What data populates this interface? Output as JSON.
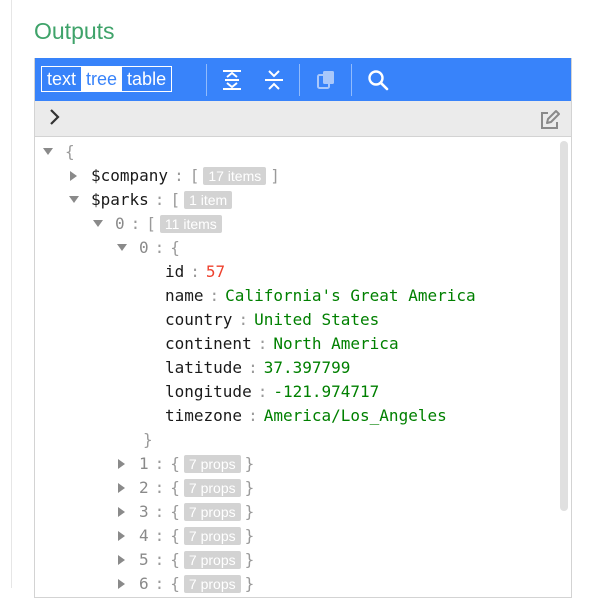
{
  "panel": {
    "title": "Outputs"
  },
  "toolbar": {
    "modes": [
      "text",
      "tree",
      "table"
    ],
    "active_mode": "tree",
    "accent": "#3883fa",
    "buttons": [
      "expand-all-icon",
      "collapse-all-icon",
      "copy-icon",
      "search-icon"
    ]
  },
  "tree": {
    "root_open": "{",
    "company": {
      "key": "$company",
      "open": "[",
      "badge": "17 items",
      "close": "]"
    },
    "parks": {
      "key": "$parks",
      "open": "[",
      "badge": "1 item"
    },
    "group": {
      "index": "0",
      "open": "[",
      "badge": "11 items"
    },
    "park": {
      "index": "0",
      "open": "{",
      "close": "}",
      "fields": [
        {
          "key": "id",
          "value": "57",
          "type": "number"
        },
        {
          "key": "name",
          "value": "California's Great America",
          "type": "string"
        },
        {
          "key": "country",
          "value": "United States",
          "type": "string"
        },
        {
          "key": "continent",
          "value": "North America",
          "type": "string"
        },
        {
          "key": "latitude",
          "value": "37.397799",
          "type": "number-green"
        },
        {
          "key": "longitude",
          "value": "-121.974717",
          "type": "number-green"
        },
        {
          "key": "timezone",
          "value": "America/Los_Angeles",
          "type": "string"
        }
      ]
    },
    "collapsed": [
      {
        "index": "1",
        "badge": "7 props"
      },
      {
        "index": "2",
        "badge": "7 props"
      },
      {
        "index": "3",
        "badge": "7 props"
      },
      {
        "index": "4",
        "badge": "7 props"
      },
      {
        "index": "5",
        "badge": "7 props"
      },
      {
        "index": "6",
        "badge": "7 props"
      }
    ]
  }
}
